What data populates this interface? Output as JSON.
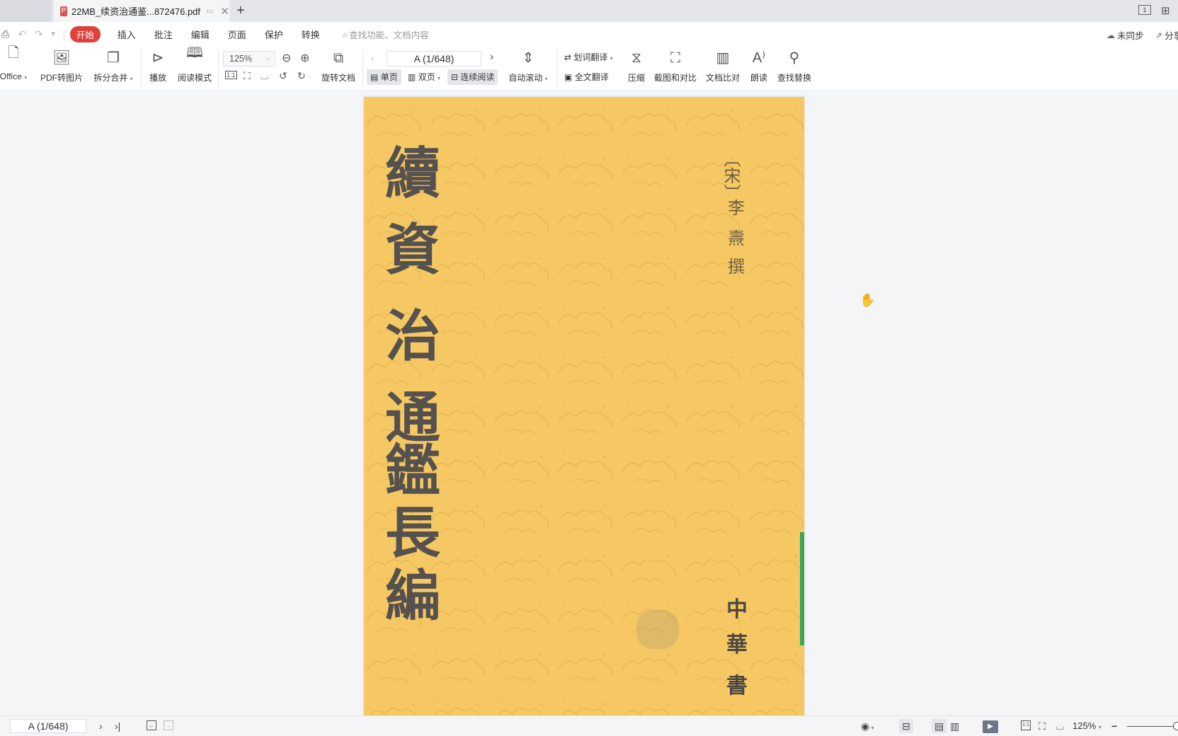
{
  "tabs": {
    "prev_tab_label": "",
    "active_tab_title": "22MB_续资治通鉴...872476.pdf",
    "new_tab_label": "+"
  },
  "window_controls": {
    "layout_label": "1",
    "grid_label": "▦"
  },
  "menu": {
    "quick_access": [
      "print",
      "undo",
      "redo",
      "more"
    ],
    "items": [
      "开始",
      "插入",
      "批注",
      "编辑",
      "页面",
      "保护",
      "转换"
    ],
    "active": "开始",
    "search_placeholder": "查找功能、文档内容",
    "sync_label": "未同步",
    "share_label": "分享"
  },
  "toolbar": {
    "to_office": "Office",
    "pdf_to_image": "PDF转图片",
    "split_merge": "拆分合并",
    "play": "播放",
    "read_mode": "阅读模式",
    "zoom_value": "125%",
    "rotate_doc": "旋转文档",
    "page_indicator": "A (1/648)",
    "single_page": "单页",
    "double_page": "双页",
    "continuous": "连续阅读",
    "auto_scroll": "自动滚动",
    "word_translate": "划词翻译",
    "full_translate": "全文翻译",
    "compress": "压缩",
    "screenshot_compare": "截图和对比",
    "doc_compare": "文档比对",
    "read_aloud": "朗读",
    "find_replace": "查找替换"
  },
  "document": {
    "title_chars": [
      "續",
      "資",
      "治",
      "通",
      "鑑",
      "長",
      "編"
    ],
    "author_chars": [
      "〔宋〕",
      "李",
      "燾",
      "撰"
    ],
    "publisher_chars": [
      "中",
      "華",
      "書"
    ],
    "colors": {
      "cover": "#f6c863",
      "title_ink": "#54514e",
      "spine": "#3da55a"
    }
  },
  "statusbar": {
    "page_indicator": "A (1/648)",
    "zoom_value": "125%"
  }
}
